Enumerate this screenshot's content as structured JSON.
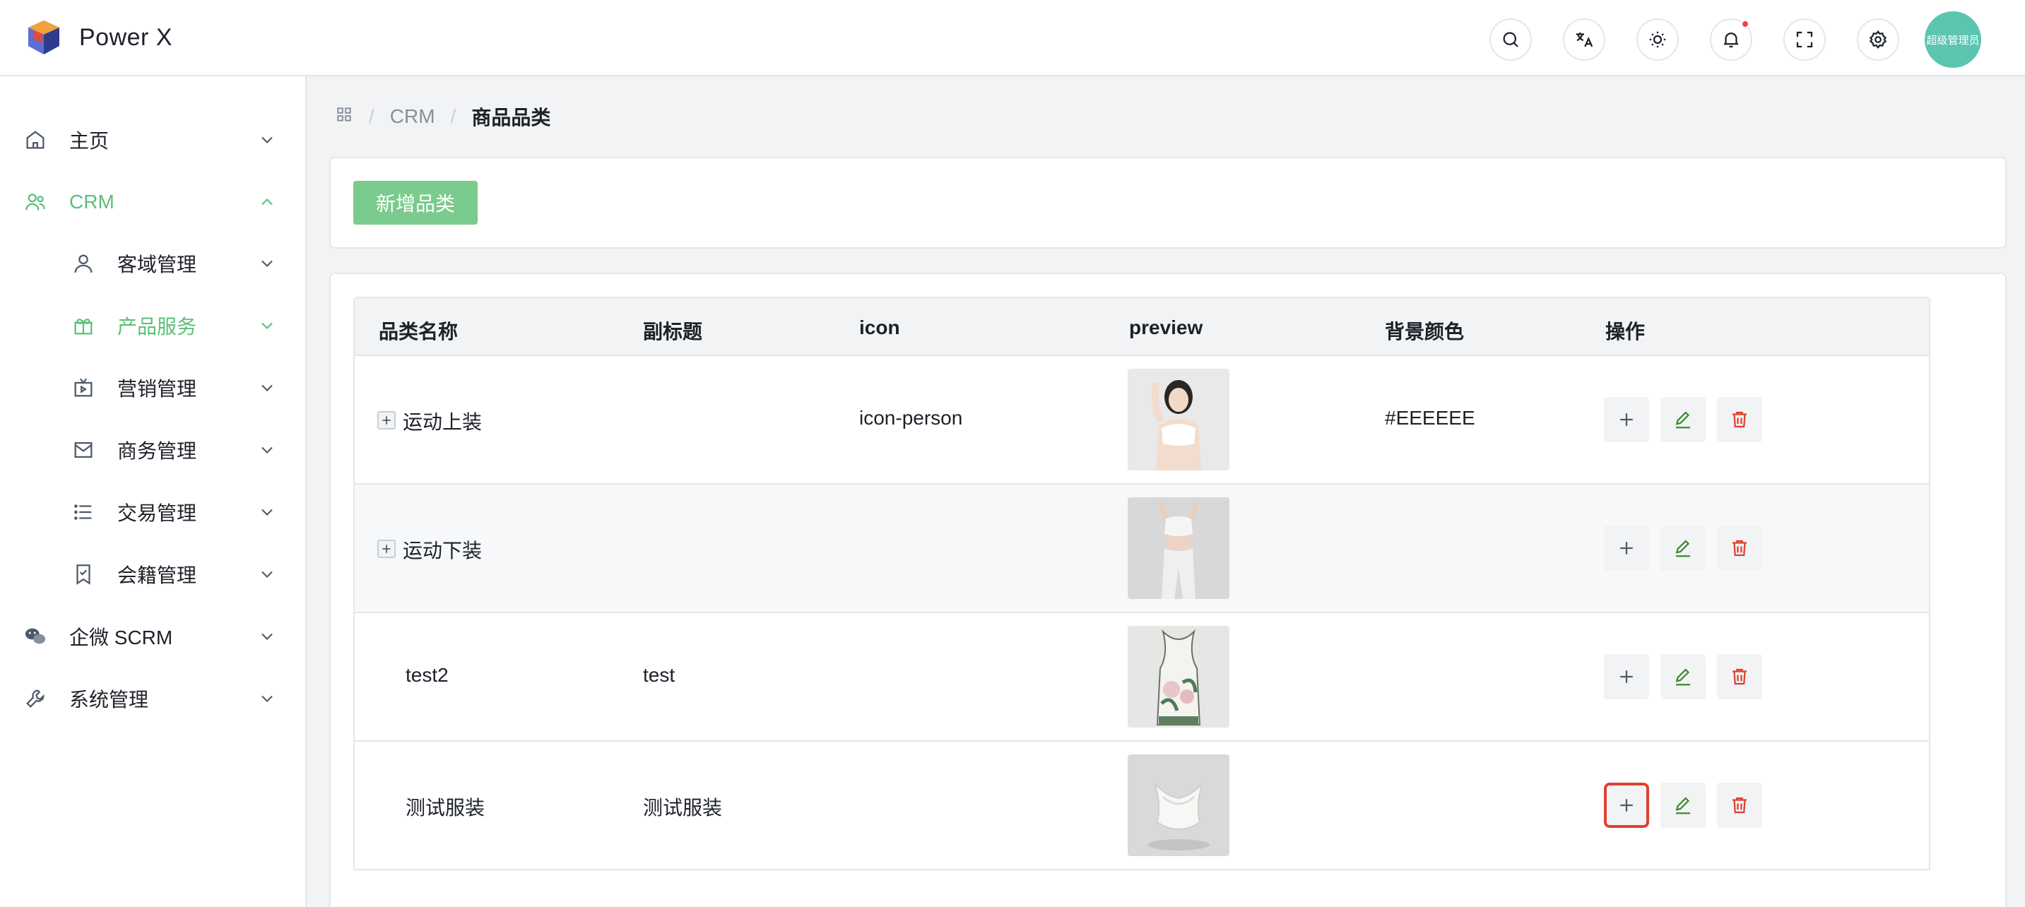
{
  "app": {
    "name": "Power X",
    "user_label": "超级管理员",
    "notification_dot_color": "#f53f3f"
  },
  "header": {
    "icons": [
      "search-icon",
      "translate-icon",
      "theme-icon",
      "bell-icon",
      "fullscreen-icon",
      "settings-icon"
    ]
  },
  "sidebar": {
    "items": [
      {
        "label": "主页",
        "icon": "home-icon",
        "level": 1,
        "expanded": false
      },
      {
        "label": "CRM",
        "icon": "users-icon",
        "level": 1,
        "expanded": true,
        "active": true
      },
      {
        "label": "客域管理",
        "icon": "user-icon",
        "level": 2,
        "expanded": false
      },
      {
        "label": "产品服务",
        "icon": "gift-icon",
        "level": 2,
        "expanded": false,
        "active": true
      },
      {
        "label": "营销管理",
        "icon": "tv-icon",
        "level": 2,
        "expanded": false
      },
      {
        "label": "商务管理",
        "icon": "mail-icon",
        "level": 2,
        "expanded": false
      },
      {
        "label": "交易管理",
        "icon": "list-icon",
        "level": 2,
        "expanded": false
      },
      {
        "label": "会籍管理",
        "icon": "bookmark-icon",
        "level": 2,
        "expanded": false
      },
      {
        "label": "企微 SCRM",
        "icon": "wechat-icon",
        "level": 1,
        "expanded": false
      },
      {
        "label": "系统管理",
        "icon": "wrench-icon",
        "level": 1,
        "expanded": false
      }
    ],
    "accent_color": "#5cbf78"
  },
  "breadcrumb": {
    "items": [
      "CRM",
      "商品品类"
    ]
  },
  "toolbar": {
    "add_category_label": "新增品类",
    "button_color": "#7acb8d"
  },
  "table": {
    "columns": [
      "品类名称",
      "副标题",
      "icon",
      "preview",
      "背景颜色",
      "操作"
    ],
    "rows": [
      {
        "name": "运动上装",
        "subtitle": "",
        "icon": "icon-person",
        "preview": "woman in white sports top",
        "bg_color": "#EEEEEE",
        "expandable": true
      },
      {
        "name": "运动下装",
        "subtitle": "",
        "icon": "",
        "preview": "woman in white leggings",
        "bg_color": "",
        "expandable": true
      },
      {
        "name": "test2",
        "subtitle": "test",
        "icon": "",
        "preview": "floral tank top",
        "bg_color": "",
        "expandable": false
      },
      {
        "name": "测试服装",
        "subtitle": "测试服装",
        "icon": "",
        "preview": "white sports bra",
        "bg_color": "",
        "expandable": false
      }
    ],
    "actions": [
      "add-child",
      "edit",
      "delete"
    ],
    "highlighted_action": {
      "row": 3,
      "action": "add-child"
    }
  }
}
